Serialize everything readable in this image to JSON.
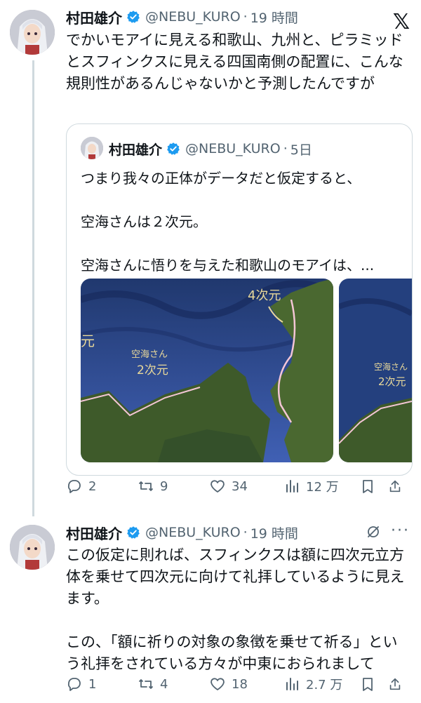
{
  "tweet1": {
    "name": "村田雄介",
    "handle": "@NEBU_KURO",
    "time": "19 時間",
    "text": "でかいモアイに見える和歌山、九州と、ピラミッドとスフィンクスに見える四国南側の配置に、こんな規則性があるんじゃないかと予測したんですが",
    "quote": {
      "name": "村田雄介",
      "handle": "@NEBU_KURO",
      "time": "5日",
      "text": "つまり我々の正体がデータだと仮定すると、\n\n空海さんは２次元。\n\n空海さんに悟りを与えた和歌山のモアイは、...",
      "map_labels": {
        "label_4d": "4次元",
        "label_kukai_1": "空海さん",
        "label_kukai_2": "2次元",
        "label_left": "元"
      }
    },
    "stats": {
      "replies": "2",
      "retweets": "9",
      "likes": "34",
      "views": "12 万"
    }
  },
  "tweet2": {
    "name": "村田雄介",
    "handle": "@NEBU_KURO",
    "time": "19 時間",
    "text": "この仮定に則れば、スフィンクスは額に四次元立方体を乗せて四次元に向けて礼拝しているように見えます。\n\nこの、「額に祈りの対象の象徴を乗せて祈る」という礼拝をされている方々が中東におられまして",
    "stats": {
      "replies": "1",
      "retweets": "4",
      "likes": "18",
      "views": "2.7 万"
    }
  },
  "icons": {
    "verified": "verified-badge-icon",
    "x_logo": "x-logo-icon",
    "reply": "reply-icon",
    "retweet": "retweet-icon",
    "like": "heart-icon",
    "views": "views-icon",
    "bookmark": "bookmark-icon",
    "share": "share-icon",
    "grok": "grok-icon",
    "more": "more-icon"
  },
  "colors": {
    "verified": "#1d9bf0",
    "secondary": "#536471",
    "border": "#cfd9de",
    "ocean": "#3d5aa6",
    "land": "#3f5a2c"
  },
  "x_logo_text": "𝕏",
  "more_text": "···"
}
